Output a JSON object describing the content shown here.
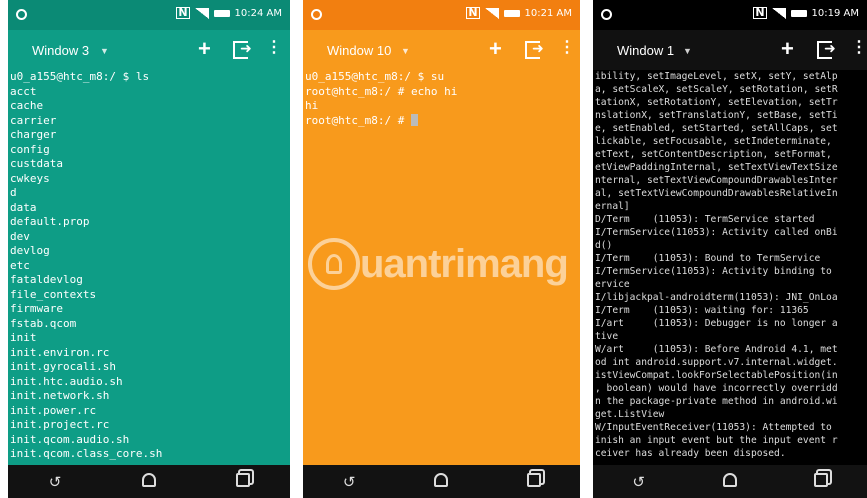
{
  "colors": {
    "teal": "#0e9d86",
    "orange": "#f89a1c",
    "black": "#000000"
  },
  "phones": [
    {
      "time": "10:24 AM",
      "window_title": "Window 3",
      "terminal_lines": [
        "u0_a155@htc_m8:/ $ ls",
        "acct",
        "cache",
        "carrier",
        "charger",
        "config",
        "custdata",
        "cwkeys",
        "d",
        "data",
        "default.prop",
        "dev",
        "devlog",
        "etc",
        "fataldevlog",
        "file_contexts",
        "firmware",
        "fstab.qcom",
        "init",
        "init.environ.rc",
        "init.gyrocali.sh",
        "init.htc.audio.sh",
        "init.network.sh",
        "init.power.rc",
        "init.project.rc",
        "init.qcom.audio.sh",
        "init.qcom.class_core.sh"
      ]
    },
    {
      "time": "10:21 AM",
      "window_title": "Window 10",
      "terminal_lines": [
        "u0_a155@htc_m8:/ $ su",
        "root@htc_m8:/ # echo hi",
        "hi"
      ],
      "prompt": "root@htc_m8:/ # "
    },
    {
      "time": "10:19 AM",
      "window_title": "Window 1",
      "terminal_lines": [
        "ibility, setImageLevel, setX, setY, setAlp",
        "a, setScaleX, setScaleY, setRotation, setR",
        "tationX, setRotationY, setElevation, setTr",
        "nslationX, setTranslationY, setBase, setTi",
        "e, setEnabled, setStarted, setAllCaps, set",
        "lickable, setFocusable, setIndeterminate,",
        "etText, setContentDescription, setFormat,",
        "etViewPaddingInternal, setTextViewTextSize",
        "nternal, setTextViewCompoundDrawablesInter",
        "al, setTextViewCompoundDrawablesRelativeIn",
        "ernal]",
        "D/Term    (11053): TermService started",
        "I/TermService(11053): Activity called onBi",
        "d()",
        "I/Term    (11053): Bound to TermService",
        "I/TermService(11053): Activity binding to",
        "ervice",
        "I/libjackpal-androidterm(11053): JNI_OnLoa",
        "I/Term    (11053): waiting for: 11365",
        "I/art     (11053): Debugger is no longer a",
        "tive",
        "W/art     (11053): Before Android 4.1, met",
        "od int android.support.v7.internal.widget.",
        "istViewCompat.lookForSelectablePosition(in",
        ", boolean) would have incorrectly overridd",
        "n the package-private method in android.wi",
        "get.ListView",
        "W/InputEventReceiver(11053): Attempted to",
        "inish an input event but the input event r",
        "ceiver has already been disposed."
      ]
    }
  ],
  "watermark": {
    "text": "uantrimang"
  },
  "icons": {
    "status": [
      "notification-dot-icon",
      "nfc-icon",
      "signal-icon",
      "battery-icon"
    ],
    "appbar": [
      "dropdown-caret-icon",
      "add-icon",
      "exit-icon",
      "overflow-menu-icon"
    ],
    "nav": [
      "back-icon",
      "home-icon",
      "recents-icon"
    ]
  }
}
